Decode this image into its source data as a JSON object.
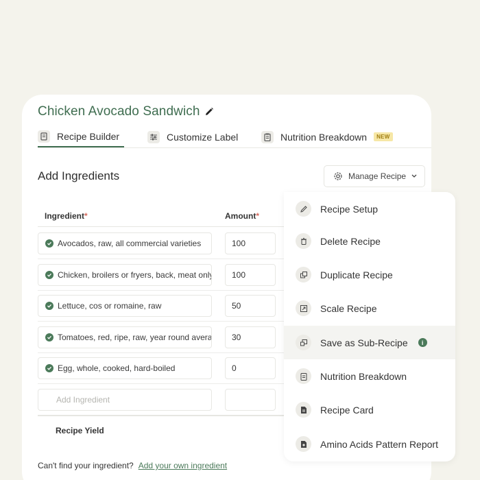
{
  "recipe": {
    "title": "Chicken Avocado Sandwich"
  },
  "tabs": [
    {
      "label": "Recipe Builder"
    },
    {
      "label": "Customize Label"
    },
    {
      "label": "Nutrition Breakdown",
      "badge": "NEW"
    }
  ],
  "section": {
    "title": "Add Ingredients"
  },
  "manage_button": {
    "label": "Manage Recipe"
  },
  "table": {
    "headers": {
      "ingredient": "Ingredient",
      "amount": "Amount",
      "required_mark": "*"
    },
    "rows": [
      {
        "ingredient": "Avocados, raw, all commercial varieties",
        "amount": "100"
      },
      {
        "ingredient": "Chicken, broilers or fryers, back, meat only, raw",
        "amount": "100"
      },
      {
        "ingredient": "Lettuce, cos or romaine, raw",
        "amount": "50"
      },
      {
        "ingredient": "Tomatoes, red, ripe, raw, year round average",
        "amount": "30"
      },
      {
        "ingredient": "Egg, whole, cooked, hard-boiled",
        "amount": "0"
      }
    ],
    "add_placeholder": "Add Ingredient",
    "yield_label": "Recipe Yield"
  },
  "footer": {
    "prompt": "Can't find your ingredient?",
    "link": "Add your own ingredient"
  },
  "menu": {
    "items": [
      {
        "label": "Recipe Setup",
        "icon": "pencil-icon"
      },
      {
        "label": "Delete Recipe",
        "icon": "trash-icon"
      },
      {
        "label": "Duplicate Recipe",
        "icon": "duplicate-icon"
      },
      {
        "label": "Scale Recipe",
        "icon": "scale-icon"
      },
      {
        "label": "Save as Sub-Recipe",
        "icon": "sub-recipe-icon",
        "info": "i"
      },
      {
        "label": "Nutrition Breakdown",
        "icon": "clipboard-icon"
      },
      {
        "label": "Recipe Card",
        "icon": "document-icon"
      },
      {
        "label": "Amino Acids Pattern Report",
        "icon": "report-icon"
      }
    ]
  },
  "colors": {
    "brand_green": "#3f6d50",
    "accent_link": "#4b7a5a",
    "required_red": "#d66a5e",
    "new_badge_bg": "#f6e7a6"
  }
}
